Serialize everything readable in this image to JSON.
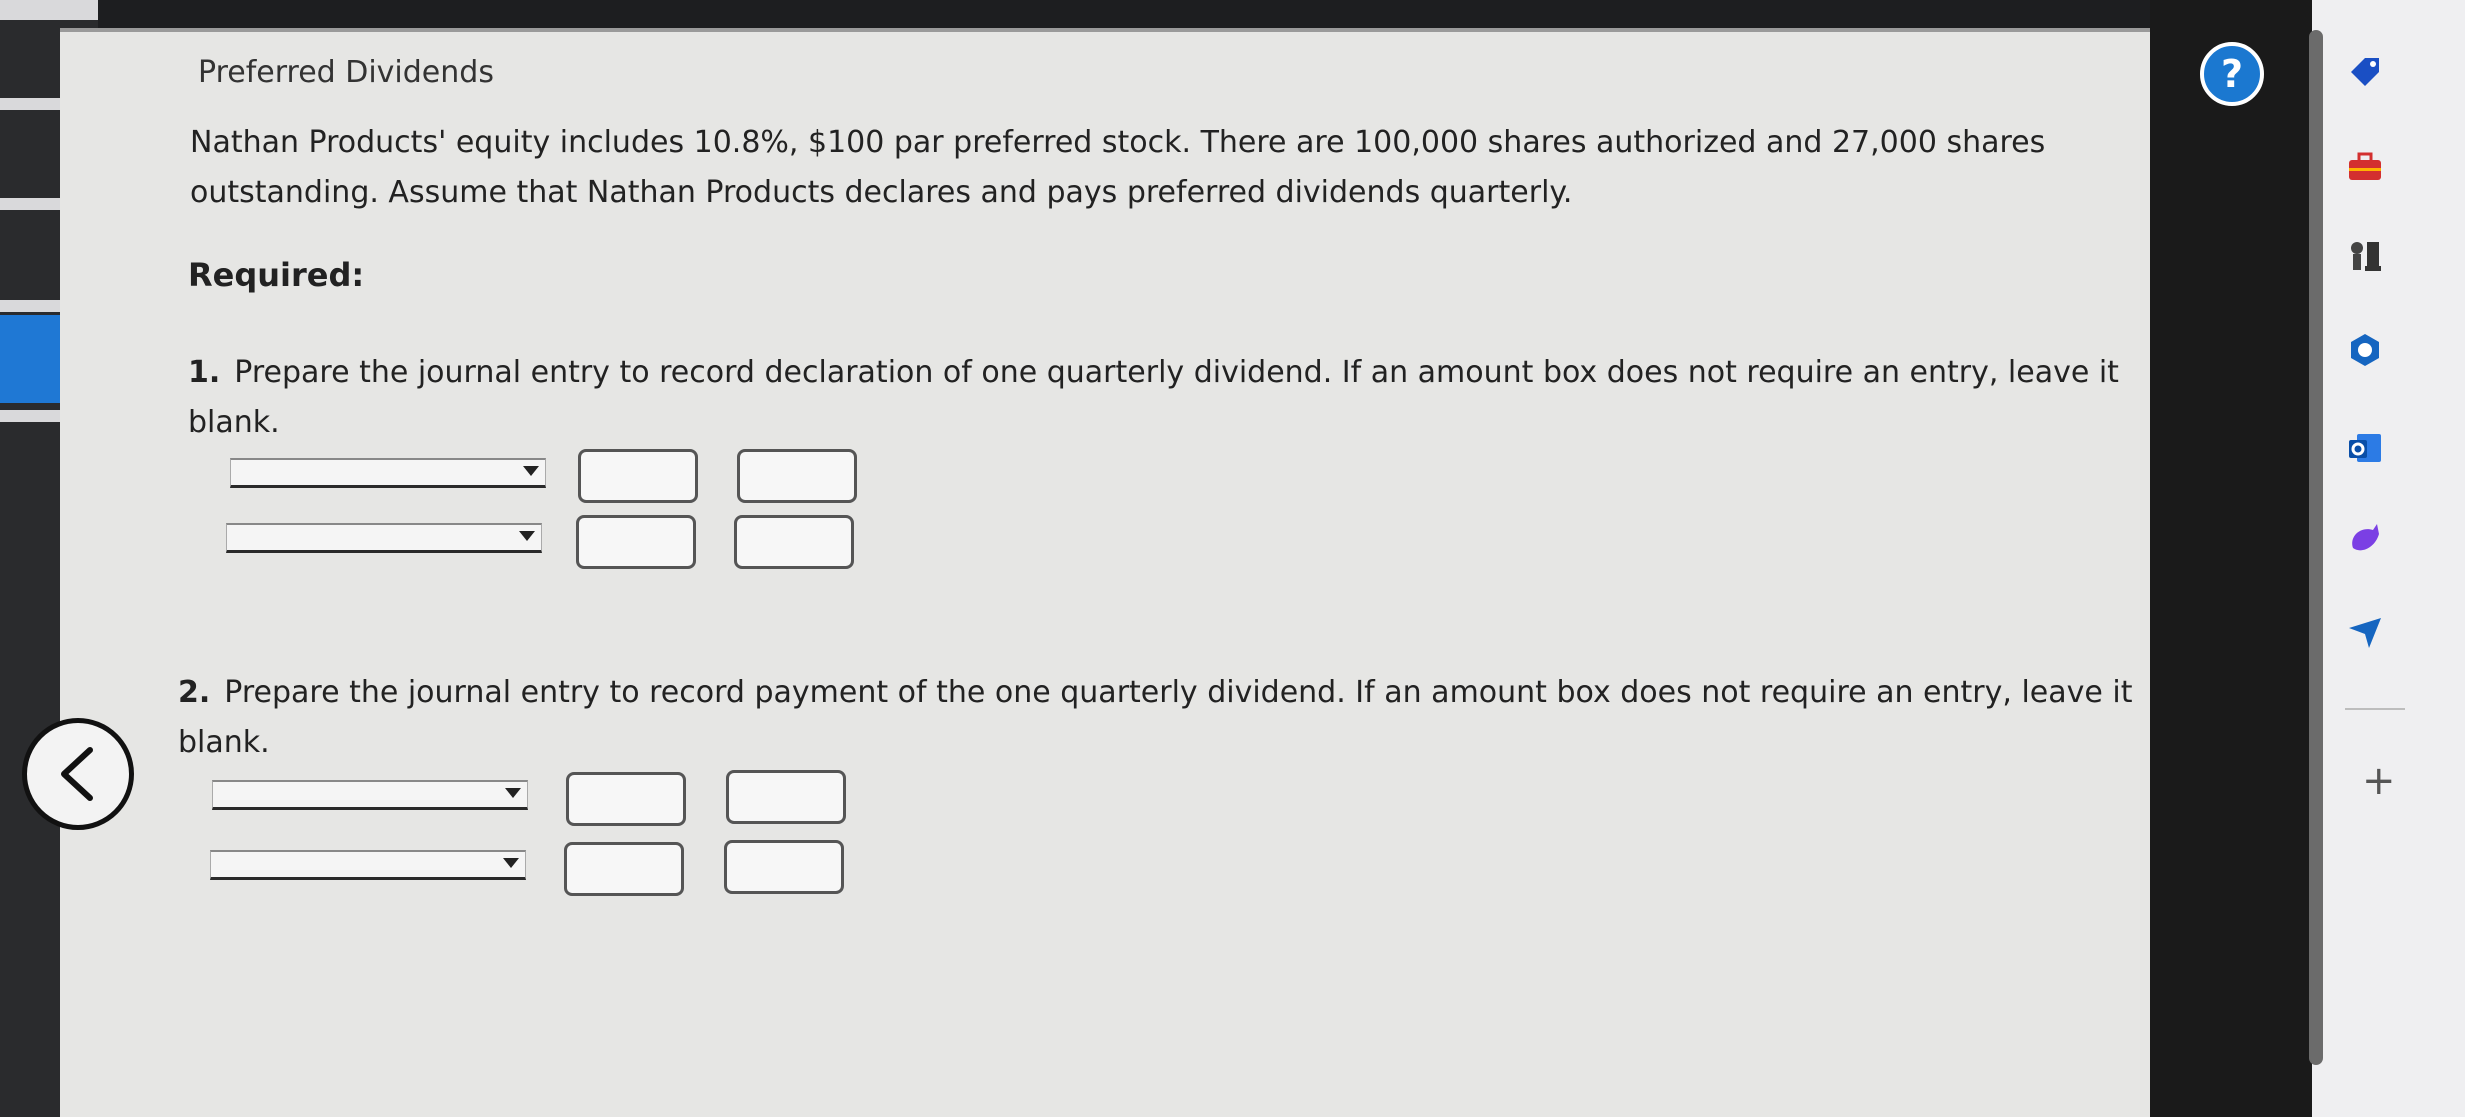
{
  "problem": {
    "title": "Preferred Dividends",
    "description": "Nathan Products' equity includes 10.8%, $100 par preferred stock. There are 100,000 shares authorized and 27,000 shares outstanding. Assume that Nathan Products declares and pays preferred dividends quarterly.",
    "required_label": "Required:",
    "q1_number": "1.",
    "q1_text": "Prepare the journal entry to record declaration of one quarterly dividend. If an amount box does not require an entry, leave it blank.",
    "q2_number": "2.",
    "q2_text": "Prepare the journal entry to record payment of the one quarterly dividend. If an amount box does not require an entry, leave it blank."
  },
  "help_label": "?",
  "sidebar_plus": "+",
  "icons": [
    "back-arrow-icon",
    "help-icon",
    "tag-icon",
    "toolbox-icon",
    "chess-icon",
    "copilot-icon",
    "outlook-icon",
    "designer-icon",
    "send-icon"
  ],
  "colors": {
    "accent": "#1b78d0",
    "page": "#e6e6e4"
  }
}
